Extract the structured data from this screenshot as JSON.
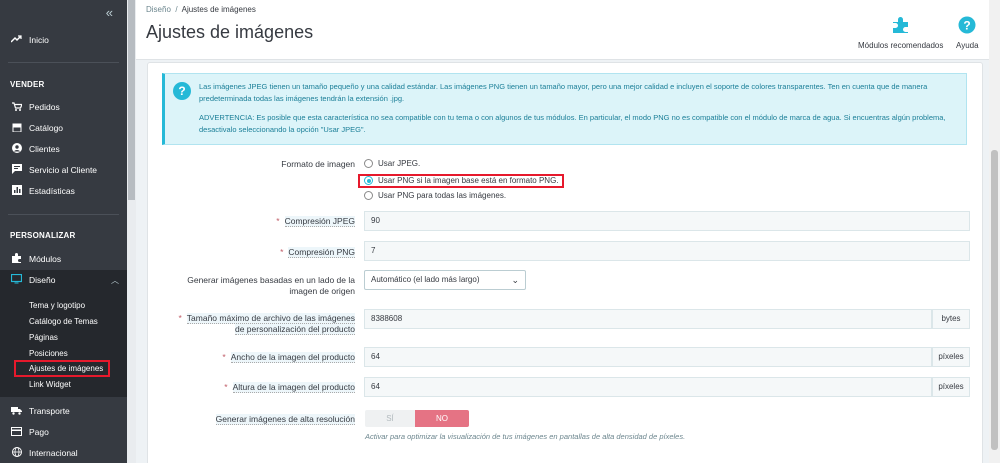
{
  "sidebar": {
    "collapse_icon": "«",
    "items": {
      "inicio": "Inicio",
      "section_vender": "VENDER",
      "pedidos": "Pedidos",
      "catalogo": "Catálogo",
      "clientes": "Clientes",
      "servicio": "Servicio al Cliente",
      "estadisticas": "Estadísticas",
      "section_personalizar": "PERSONALIZAR",
      "modulos": "Módulos",
      "diseno": "Diseño",
      "transporte": "Transporte",
      "pago": "Pago",
      "internacional": "Internacional"
    },
    "subitems": [
      "Tema y logotipo",
      "Catálogo de Temas",
      "Páginas",
      "Posiciones",
      "Ajustes de imágenes",
      "Link Widget"
    ]
  },
  "header": {
    "breadcrumb_parent": "Diseño",
    "breadcrumb_sep": "/",
    "breadcrumb_current": "Ajustes de imágenes",
    "title": "Ajustes de imágenes",
    "modules_btn": "Módulos recomendados",
    "help_btn": "Ayuda"
  },
  "alert": {
    "line1": "Las imágenes JPEG tienen un tamaño pequeño y una calidad estándar. Las imágenes PNG tienen un tamaño mayor, pero una mejor calidad e incluyen el soporte de colores transparentes. Ten en cuenta que de manera predeterminada todas las imágenes tendrán la extensión .jpg.",
    "line2": "ADVERTENCIA: Es posible que esta característica no sea compatible con tu tema o con algunos de tus módulos. En particular, el modo PNG no es compatible con el módulo de marca de agua. Si encuentras algún problema, desactivalo seleccionando la opción \"Usar JPEG\"."
  },
  "form": {
    "format_label": "Formato de imagen",
    "format_options": [
      "Usar JPEG.",
      "Usar PNG si la imagen base está en formato PNG.",
      "Usar PNG para todas las imágenes."
    ],
    "format_selected": 1,
    "req": "*",
    "jpeg_label": "Compresión JPEG",
    "jpeg_value": "90",
    "png_label": "Compresión PNG",
    "png_value": "7",
    "generate_label_1": "Generar imágenes basadas en un lado de la",
    "generate_label_2": "imagen de origen",
    "generate_value": "Automático (el lado más largo)",
    "maxsize_label_1": "Tamaño máximo de archivo de las imágenes",
    "maxsize_label_2": "de personalización del producto",
    "maxsize_value": "8388608",
    "maxsize_unit": "bytes",
    "width_label": "Ancho de la imagen del producto",
    "width_value": "64",
    "width_unit": "píxeles",
    "height_label": "Altura de la imagen del producto",
    "height_value": "64",
    "height_unit": "píxeles",
    "hires_label": "Generar imágenes de alta resolución",
    "hires_yes": "SÍ",
    "hires_no": "NO",
    "hires_value": "NO",
    "hires_help": "Activar para optimizar la visualización de tus imágenes en pantallas de alta densidad de píxeles."
  },
  "colors": {
    "sidebar_bg": "#363a41",
    "accent": "#25b9d7",
    "highlight": "#e6192c",
    "switch_no": "#e57384"
  }
}
